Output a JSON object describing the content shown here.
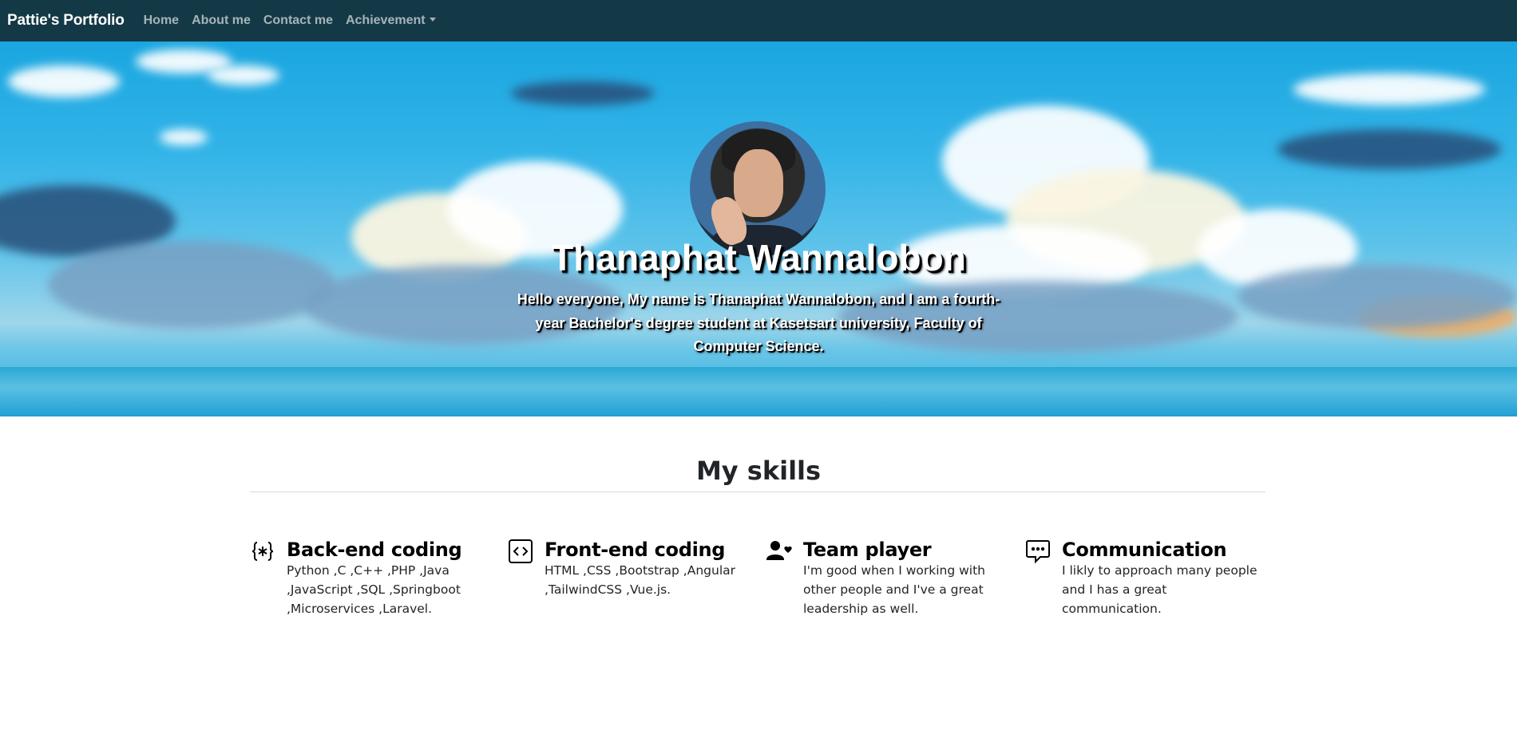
{
  "navbar": {
    "brand": "Pattie's Portfolio",
    "links": [
      {
        "label": "Home"
      },
      {
        "label": "About me"
      },
      {
        "label": "Contact me"
      },
      {
        "label": "Achievement"
      }
    ],
    "background": "#143946"
  },
  "hero": {
    "name": "Thanaphat Wannalobon",
    "intro": "Hello everyone, My name is Thanaphat Wannalobon, and I am a fourth-year Bachelor's degree student at Kasetsart university, Faculty of Computer Science."
  },
  "skills": {
    "heading": "My skills",
    "items": [
      {
        "icon": "braces-asterisk-icon",
        "title": "Back-end coding",
        "description": "Python ,C ,C++ ,PHP ,Java ,JavaScript ,SQL ,Springboot ,Microservices ,Laravel."
      },
      {
        "icon": "code-square-icon",
        "title": "Front-end coding",
        "description": "HTML ,CSS ,Bootstrap ,Angular ,TailwindCSS ,Vue.js."
      },
      {
        "icon": "person-heart-icon",
        "title": "Team player",
        "description": "I'm good when I working with other people and I've a great leadership as well."
      },
      {
        "icon": "chat-dots-icon",
        "title": "Communication",
        "description": "I likly to approach many people and I has a great communication."
      }
    ]
  }
}
